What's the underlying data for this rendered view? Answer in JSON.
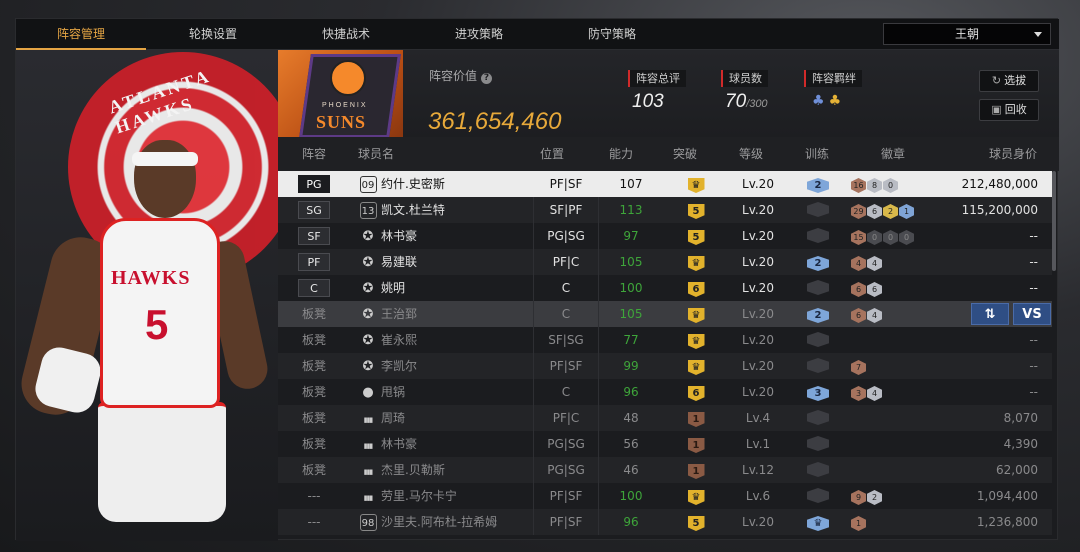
{
  "nav": {
    "tabs": [
      "阵容管理",
      "轮换设置",
      "快捷战术",
      "进攻策略",
      "防守策略"
    ],
    "active_tab": "阵容管理",
    "server_select": "王朝"
  },
  "team_info": {
    "team_value_label": "阵容价值",
    "team_value": "361,654,460",
    "overall_label": "阵容总评",
    "overall": "103",
    "players_label": "球员数",
    "players_count": "70",
    "players_cap": "/300",
    "bond_label": "阵容羁绊",
    "select_button": "选拔",
    "recycle_button": "回收",
    "logo_text_top": "PHOENIX",
    "logo_text_main": "SUNS",
    "poster_team": "ATLANTA HAWKS",
    "jersey_name": "HAWKS",
    "jersey_number": "5"
  },
  "table": {
    "headers": {
      "role": "阵容",
      "name": "球员名",
      "position": "位置",
      "ability": "能力",
      "breakthrough": "突破",
      "level": "等级",
      "training": "训练",
      "badges": "徽章",
      "value": "球员身价"
    },
    "rows": [
      {
        "role": "PG",
        "num": "09",
        "name": "约什.史密斯",
        "pos": "PF|SF",
        "ability": "107",
        "brk": "crown",
        "lv": "Lv.20",
        "train": "2",
        "badges": [
          [
            "b",
            "16"
          ],
          [
            "s",
            "8"
          ],
          [
            "s",
            "0"
          ]
        ],
        "value": "212,480,000"
      },
      {
        "role": "SG",
        "num": "13",
        "name": "凯文.杜兰特",
        "pos": "SF|PF",
        "ability": "113",
        "brk": "5",
        "lv": "Lv.20",
        "train": "",
        "badges": [
          [
            "b",
            "29"
          ],
          [
            "s",
            "6"
          ],
          [
            "g",
            "2"
          ],
          [
            "d",
            "1"
          ]
        ],
        "value": "115,200,000"
      },
      {
        "role": "SF",
        "num": "",
        "name": "林书豪",
        "pos": "PG|SG",
        "ability": "97",
        "brk": "5",
        "lv": "Lv.20",
        "train": "",
        "badges": [
          [
            "b",
            "15"
          ],
          [
            "e",
            "0"
          ],
          [
            "e",
            "0"
          ],
          [
            "e",
            "0"
          ]
        ],
        "value": "--"
      },
      {
        "role": "PF",
        "num": "",
        "name": "易建联",
        "pos": "PF|C",
        "ability": "105",
        "brk": "crown",
        "lv": "Lv.20",
        "train": "2",
        "badges": [
          [
            "b",
            "4"
          ],
          [
            "s",
            "4"
          ]
        ],
        "value": "--"
      },
      {
        "role": "C",
        "num": "",
        "name": "姚明",
        "pos": "C",
        "ability": "100",
        "brk": "6",
        "lv": "Lv.20",
        "train": "",
        "badges": [
          [
            "b",
            "6"
          ],
          [
            "s",
            "6"
          ]
        ],
        "value": "--"
      },
      {
        "role": "板凳",
        "num": "",
        "name": "王治郅",
        "pos": "C",
        "ability": "105",
        "brk": "crown",
        "lv": "Lv.20",
        "train": "2",
        "badges": [
          [
            "b",
            "6"
          ],
          [
            "s",
            "4"
          ]
        ],
        "value": ""
      },
      {
        "role": "板凳",
        "num": "",
        "name": "崔永熙",
        "pos": "SF|SG",
        "ability": "77",
        "brk": "crown",
        "lv": "Lv.20",
        "train": "",
        "badges": [],
        "value": "--"
      },
      {
        "role": "板凳",
        "num": "",
        "name": "李凯尔",
        "pos": "PF|SF",
        "ability": "99",
        "brk": "crown",
        "lv": "Lv.20",
        "train": "",
        "badges": [
          [
            "b",
            "7"
          ]
        ],
        "value": "--"
      },
      {
        "role": "板凳",
        "num": "",
        "name": "甩锅",
        "pos": "C",
        "ability": "96",
        "brk": "6",
        "lv": "Lv.20",
        "train": "3",
        "badges": [
          [
            "b",
            "3"
          ],
          [
            "s",
            "4"
          ]
        ],
        "value": "--"
      },
      {
        "role": "板凳",
        "num": "",
        "name": "周琦",
        "pos": "PF|C",
        "ability": "48",
        "brk": "1",
        "lv": "Lv.4",
        "train": "",
        "badges": [],
        "value": "8,070"
      },
      {
        "role": "板凳",
        "num": "",
        "name": "林书豪",
        "pos": "PG|SG",
        "ability": "56",
        "brk": "1",
        "lv": "Lv.1",
        "train": "",
        "badges": [],
        "value": "4,390"
      },
      {
        "role": "板凳",
        "num": "",
        "name": "杰里.贝勒斯",
        "pos": "PG|SG",
        "ability": "46",
        "brk": "1",
        "lv": "Lv.12",
        "train": "",
        "badges": [],
        "value": "62,000"
      },
      {
        "role": "---",
        "num": "",
        "name": "劳里.马尔卡宁",
        "pos": "PF|SF",
        "ability": "100",
        "brk": "crown",
        "lv": "Lv.6",
        "train": "",
        "badges": [
          [
            "b",
            "9"
          ],
          [
            "s",
            "2"
          ]
        ],
        "value": "1,094,400"
      },
      {
        "role": "---",
        "num": "98",
        "name": "沙里夫.阿布杜-拉希姆",
        "pos": "PF|SF",
        "ability": "96",
        "brk": "5",
        "lv": "Lv.20",
        "train": "crown",
        "badges": [
          [
            "b",
            "1"
          ]
        ],
        "value": "1,236,800"
      }
    ],
    "swap_button": "⇅",
    "vs_button": "VS"
  }
}
